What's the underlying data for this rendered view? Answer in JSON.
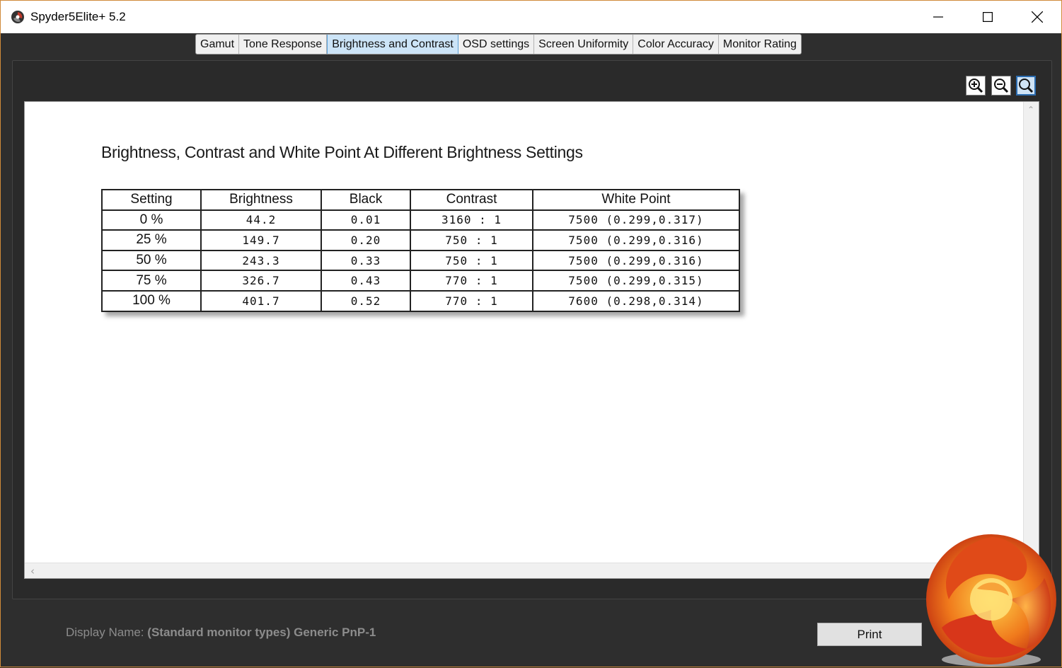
{
  "window": {
    "title": "Spyder5Elite+ 5.2",
    "controls": {
      "minimize": "minimize-icon",
      "maximize": "maximize-icon",
      "close": "close-icon"
    }
  },
  "tabs": [
    {
      "label": "Gamut",
      "active": false
    },
    {
      "label": "Tone Response",
      "active": false
    },
    {
      "label": "Brightness and Contrast",
      "active": true
    },
    {
      "label": "OSD settings",
      "active": false
    },
    {
      "label": "Screen Uniformity",
      "active": false
    },
    {
      "label": "Color Accuracy",
      "active": false
    },
    {
      "label": "Monitor Rating",
      "active": false
    }
  ],
  "zoom": {
    "zoom_in": "zoom-in-icon",
    "zoom_out": "zoom-out-icon",
    "zoom_fit": "zoom-fit-icon"
  },
  "report": {
    "title": "Brightness, Contrast and White Point At Different Brightness Settings",
    "headers": [
      "Setting",
      "Brightness",
      "Black",
      "Contrast",
      "White Point"
    ],
    "rows": [
      [
        "0 %",
        "44.2",
        "0.01",
        "3160 : 1",
        "7500 (0.299,0.317)"
      ],
      [
        "25 %",
        "149.7",
        "0.20",
        "750 : 1",
        "7500 (0.299,0.316)"
      ],
      [
        "50 %",
        "243.3",
        "0.33",
        "750 : 1",
        "7500 (0.299,0.316)"
      ],
      [
        "75 %",
        "326.7",
        "0.43",
        "770 : 1",
        "7500 (0.299,0.315)"
      ],
      [
        "100 %",
        "401.7",
        "0.52",
        "770 : 1",
        "7600 (0.298,0.314)"
      ]
    ]
  },
  "footer": {
    "display_name_label": "Display Name:",
    "display_name_value": "(Standard monitor types) Generic PnP-1",
    "print_label": "Print"
  },
  "colors": {
    "accent_border": "#d08a3a",
    "active_tab": "#cce4f7",
    "panel_bg": "#2a2a2a"
  }
}
